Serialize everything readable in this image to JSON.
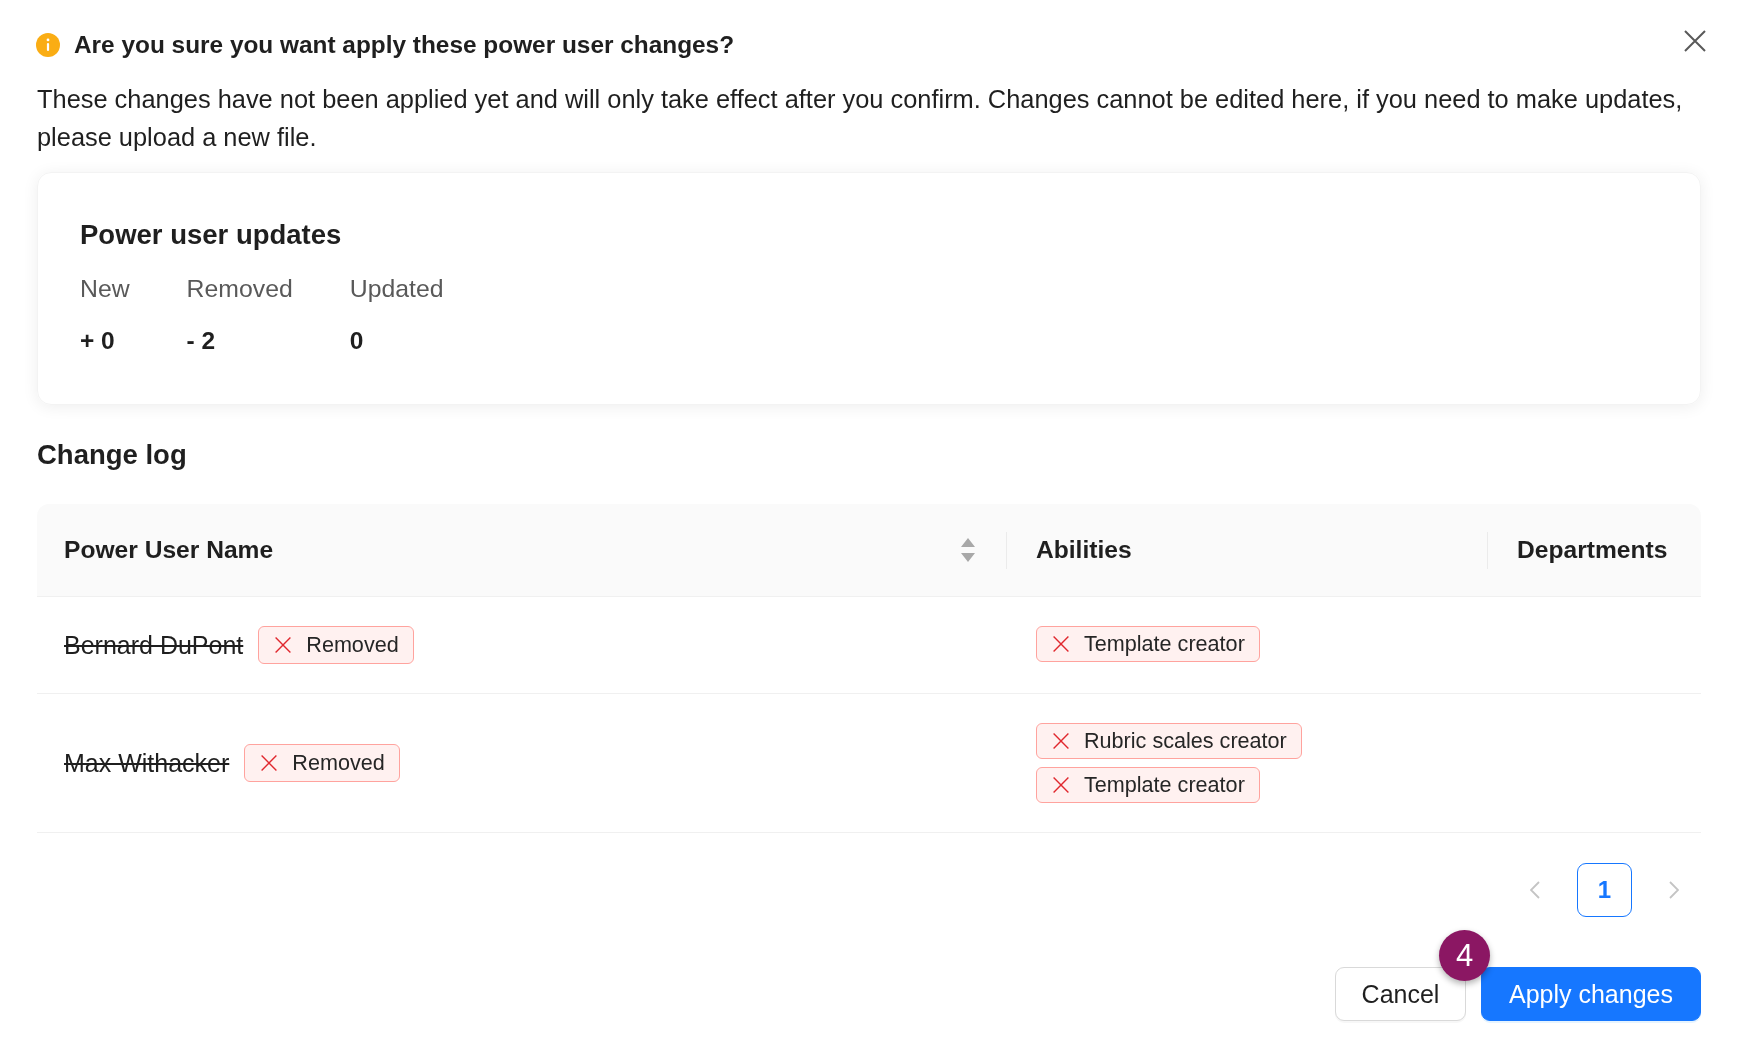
{
  "dialog": {
    "title": "Are you sure you want apply these power user changes?",
    "message": "These changes have not been applied yet and will only take effect after you confirm. Changes cannot be edited here, if you need to make updates, please upload a new file."
  },
  "summary": {
    "title": "Power user updates",
    "stats": [
      {
        "label": "New",
        "value": "+ 0"
      },
      {
        "label": "Removed",
        "value": "- 2"
      },
      {
        "label": "Updated",
        "value": "0"
      }
    ]
  },
  "change_log": {
    "title": "Change log",
    "table": {
      "columns": [
        {
          "label": "Power User Name",
          "sortable": true
        },
        {
          "label": "Abilities",
          "sortable": false
        },
        {
          "label": "Departments",
          "sortable": false
        }
      ],
      "rows": [
        {
          "name": "Bernard DuPont",
          "status": {
            "kind": "removed",
            "label": "Removed"
          },
          "abilities": [
            {
              "kind": "removed",
              "label": "Template creator"
            }
          ]
        },
        {
          "name": "Max Withacker",
          "status": {
            "kind": "removed",
            "label": "Removed"
          },
          "abilities": [
            {
              "kind": "removed",
              "label": "Rubric scales creator"
            },
            {
              "kind": "removed",
              "label": "Template creator"
            }
          ]
        }
      ]
    }
  },
  "pagination": {
    "previous": {
      "disabled": true
    },
    "pages": [
      {
        "label": "1",
        "selected": true
      }
    ],
    "next": {
      "disabled": true
    }
  },
  "buttons": [
    {
      "label": "Cancel",
      "kind": "secondary"
    },
    {
      "label": "Apply changes",
      "kind": "primary"
    }
  ],
  "step_marker": "4"
}
